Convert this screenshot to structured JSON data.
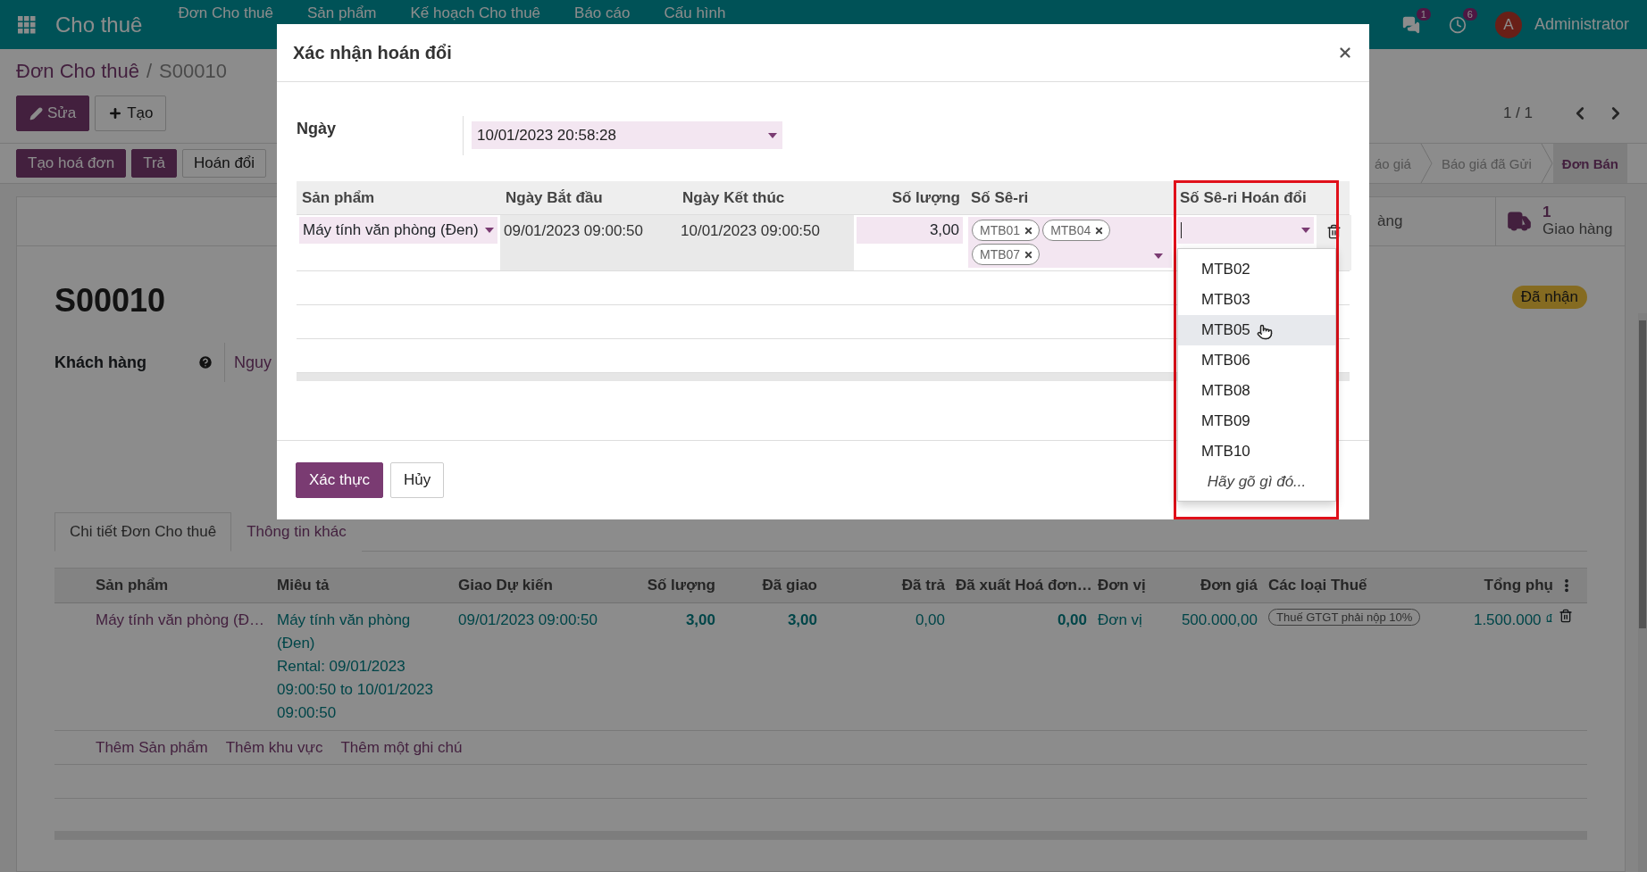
{
  "navbar": {
    "app_title": "Cho thuê",
    "menu": [
      "Đơn Cho thuê",
      "Sản phẩm",
      "Kế hoạch Cho thuê",
      "Báo cáo",
      "Cấu hình"
    ],
    "messages_count": "1",
    "activities_count": "6",
    "user_initial": "A",
    "user_name": "Administrator"
  },
  "breadcrumb": {
    "parent": "Đơn Cho thuê",
    "separator": "/",
    "current": "S00010"
  },
  "control_buttons": [
    {
      "label": "Sửa",
      "kind": "primary"
    },
    {
      "label": "Tạo",
      "kind": "secondary"
    }
  ],
  "pager": "1 / 1",
  "action_buttons": [
    {
      "label": "Tạo hoá đơn",
      "kind": "primary"
    },
    {
      "label": "Trả",
      "kind": "primary"
    },
    {
      "label": "Hoán đổi",
      "kind": "secondary"
    }
  ],
  "stages": [
    {
      "label": "áo giá",
      "selected": false
    },
    {
      "label": "Báo giá đã Gửi",
      "selected": false
    },
    {
      "label": "Đơn Bán",
      "selected": true
    }
  ],
  "smart_buttons": [
    {
      "label": "àng"
    },
    {
      "count": "1",
      "label": "Giao hàng"
    }
  ],
  "record": {
    "name": "S00010",
    "ribbon": "Đã nhận",
    "customer_label": "Khách hàng",
    "customer_value": "Nguy"
  },
  "tabs": [
    {
      "label": "Chi tiết Đơn Cho thuê",
      "selected": true
    },
    {
      "label": "Thông tin khác",
      "selected": false
    }
  ],
  "order_lines": {
    "columns": [
      "Sản phẩm",
      "Miêu tả",
      "Giao Dự kiến",
      "Số lượng",
      "Đã giao",
      "Đã trả",
      "Đã xuất Hoá đơn…",
      "Đơn vị",
      "Đơn giá",
      "Các loại Thuế",
      "Tổng phụ"
    ],
    "rows": [
      {
        "cells": [
          {
            "kind": "name",
            "text": "Máy tính văn phòng (Đ…"
          },
          {
            "kind": "link",
            "text": "Máy tính văn phòng (Đen)\nRental: 09/01/2023 09:00:50 to 10/01/2023 09:00:50"
          },
          {
            "kind": "link",
            "text": "09/01/2023 09:00:50"
          },
          {
            "kind": "strong",
            "text": "3,00"
          },
          {
            "kind": "strong",
            "text": "3,00"
          },
          {
            "kind": "link",
            "text": "0,00"
          },
          {
            "kind": "strong",
            "text": "0,00"
          },
          {
            "kind": "link",
            "text": "Đơn vị"
          },
          {
            "kind": "link",
            "text": "500.000,00"
          },
          {
            "kind": "tag",
            "text": "Thuế GTGT phải nộp 10%"
          },
          {
            "kind": "link",
            "text": "1.500.000 ₫"
          }
        ]
      }
    ],
    "add_links": [
      "Thêm Sản phẩm",
      "Thêm khu vực",
      "Thêm một ghi chú"
    ]
  },
  "dialog": {
    "title": "Xác nhận hoán đổi",
    "date_label": "Ngày",
    "date_value": "10/01/2023 20:58:28",
    "columns": [
      "Sản phẩm",
      "Ngày Bắt đầu",
      "Ngày Kết thúc",
      "Số lượng",
      "Số Sê-ri",
      "Số Sê-ri Hoán đổi"
    ],
    "line": {
      "product": "Máy tính văn phòng (Đen)",
      "start": "09/01/2023 09:00:50",
      "end": "10/01/2023 09:00:50",
      "quantity": "3,00",
      "serials": [
        "MTB01",
        "MTB04",
        "MTB07"
      ]
    },
    "dropdown": {
      "options": [
        {
          "label": "MTB02",
          "selected": false
        },
        {
          "label": "MTB03",
          "selected": false
        },
        {
          "label": "MTB05",
          "selected": true
        },
        {
          "label": "MTB06",
          "selected": false
        },
        {
          "label": "MTB08",
          "selected": false
        },
        {
          "label": "MTB09",
          "selected": false
        },
        {
          "label": "MTB10",
          "selected": false
        }
      ],
      "hint": "Hãy gõ gì đó..."
    },
    "buttons": [
      {
        "label": "Xác thực",
        "kind": "primary"
      },
      {
        "label": "Hủy",
        "kind": "secondary"
      }
    ]
  }
}
